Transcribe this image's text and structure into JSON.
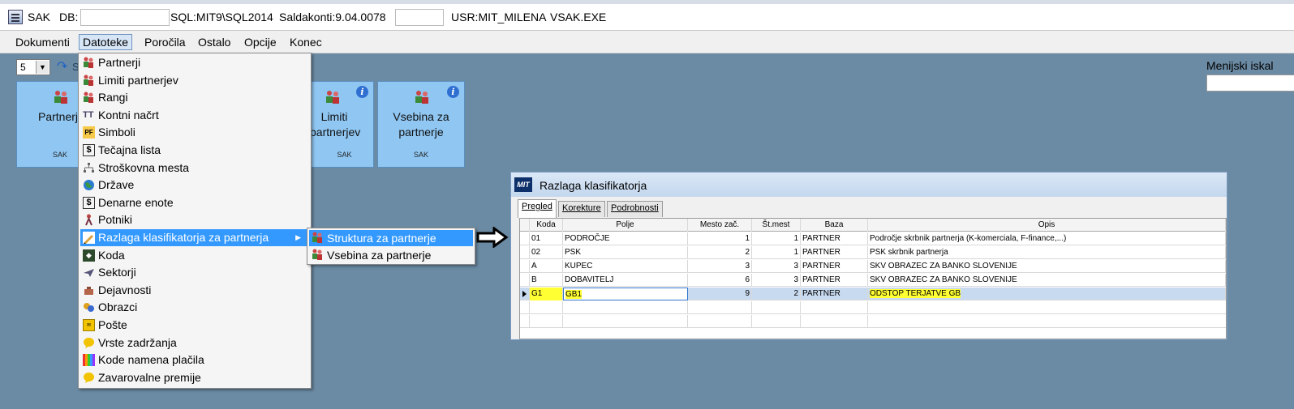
{
  "titlebar": {
    "app": "SAK",
    "db_label": "DB:",
    "sql": "SQL:MIT9\\SQL2014",
    "saldakonti": "Saldakonti:9.04.0078",
    "user": "USR:MIT_MILENA",
    "exe": "VSAK.EXE"
  },
  "menubar": {
    "items": [
      "Dokumenti",
      "Datoteke",
      "Poročila",
      "Ostalo",
      "Opcije",
      "Konec"
    ],
    "active": "Datoteke"
  },
  "toolbar": {
    "combo_value": "5",
    "small_text": "S"
  },
  "search": {
    "label": "Menijski iskal"
  },
  "tiles": [
    {
      "label": "Partnerji",
      "sub": "SAK"
    },
    {
      "label": "Limiti partnerjev",
      "sub": "SAK"
    },
    {
      "label": "Vsebina za partnerje",
      "sub": "SAK"
    }
  ],
  "dropdown": {
    "items": [
      "Partnerji",
      "Limiti partnerjev",
      "Rangi",
      "Kontni načrt",
      "Simboli",
      "Tečajna lista",
      "Stroškovna mesta",
      "Države",
      "Denarne enote",
      "Potniki",
      "Razlaga klasifikatorja za partnerja",
      "Koda",
      "Sektorji",
      "Dejavnosti",
      "Obrazci",
      "Pošte",
      "Vrste zadržanja",
      "Kode namena plačila",
      "Zavarovalne premije"
    ],
    "highlighted": "Razlaga klasifikatorja za partnerja"
  },
  "submenu": {
    "items": [
      "Struktura za partnerje",
      "Vsebina za partnerje"
    ],
    "highlighted": "Struktura za partnerje"
  },
  "dialog": {
    "title": "Razlaga klasifikatorja",
    "logo": "MIT",
    "tabs": [
      "Pregled",
      "Korekture",
      "Podrobnosti"
    ],
    "active_tab": "Pregled",
    "columns": [
      "Koda",
      "Polje",
      "Mesto zač.",
      "Št.mest",
      "Baza",
      "Opis"
    ],
    "rows": [
      {
        "koda": "01",
        "polje": "PODROČJE",
        "mesto": "1",
        "st": "1",
        "baza": "PARTNER",
        "opis": "Področje skrbnik partnerja (K-komerciala, F-finance,...)"
      },
      {
        "koda": "02",
        "polje": "PSK",
        "mesto": "2",
        "st": "1",
        "baza": "PARTNER",
        "opis": "PSK skrbnik partnerja"
      },
      {
        "koda": "A",
        "polje": "KUPEC",
        "mesto": "3",
        "st": "3",
        "baza": "PARTNER",
        "opis": "SKV OBRAZEC ZA BANKO SLOVENIJE"
      },
      {
        "koda": "B",
        "polje": "DOBAVITELJ",
        "mesto": "6",
        "st": "3",
        "baza": "PARTNER",
        "opis": "SKV OBRAZEC ZA BANKO SLOVENIJE"
      },
      {
        "koda": "G1",
        "polje": "GB1",
        "mesto": "9",
        "st": "2",
        "baza": "PARTNER",
        "opis": "ODSTOP TERJATVE GB"
      }
    ],
    "highlight_color": "#ffff33"
  }
}
